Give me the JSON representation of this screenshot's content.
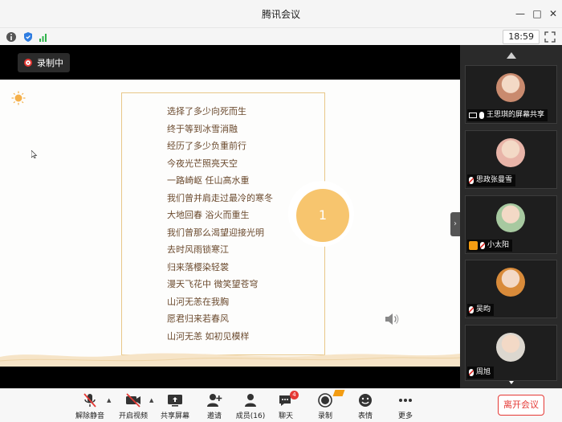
{
  "app": {
    "title": "腾讯会议"
  },
  "status": {
    "time": "18:59"
  },
  "recording": {
    "label": "录制中"
  },
  "slide": {
    "number": "1",
    "poem": [
      "选择了多少向死而生",
      "终于等到冰雪消融",
      "经历了多少负重前行",
      "今夜光芒照亮天空",
      "一路崎岖  任山高水重",
      "我们曾并肩走过最冷的寒冬",
      "大地回春  浴火而重生",
      "我们曾那么渴望迎接光明",
      "去时风雨锁寒江",
      "归来落樱染轻裳",
      "漫天飞花中  微笑望苍穹",
      "山河无恙在我胸",
      "愿君归来若春风",
      "山河无恙  如初见模样"
    ]
  },
  "participants": [
    {
      "name": "王思琪的屏幕共享",
      "avatar_color": "#c98a6e",
      "screen_share": true,
      "mic_muted": false
    },
    {
      "name": "思政张曼雪",
      "avatar_color": "#e8b4a8",
      "screen_share": false,
      "mic_muted": true
    },
    {
      "name": "小太阳",
      "avatar_color": "#a7c9a0",
      "screen_share": false,
      "mic_muted": true,
      "host_badge": true
    },
    {
      "name": "吴昀",
      "avatar_color": "#d98b3a",
      "screen_share": false,
      "mic_muted": true
    },
    {
      "name": "周旭",
      "avatar_color": "#dcd7cf",
      "screen_share": false,
      "mic_muted": true
    }
  ],
  "toolbar": {
    "unmute": "解除静音",
    "video": "开启视频",
    "share": "共享屏幕",
    "invite": "邀请",
    "members": "成员(16)",
    "chat": "聊天",
    "chat_badge": "4",
    "record": "录制",
    "emoji": "表情",
    "more": "更多",
    "leave": "离开会议"
  },
  "colors": {
    "accent_red": "#e53935",
    "poem_border": "#e8c788",
    "slide_circle": "#f7c56e"
  }
}
